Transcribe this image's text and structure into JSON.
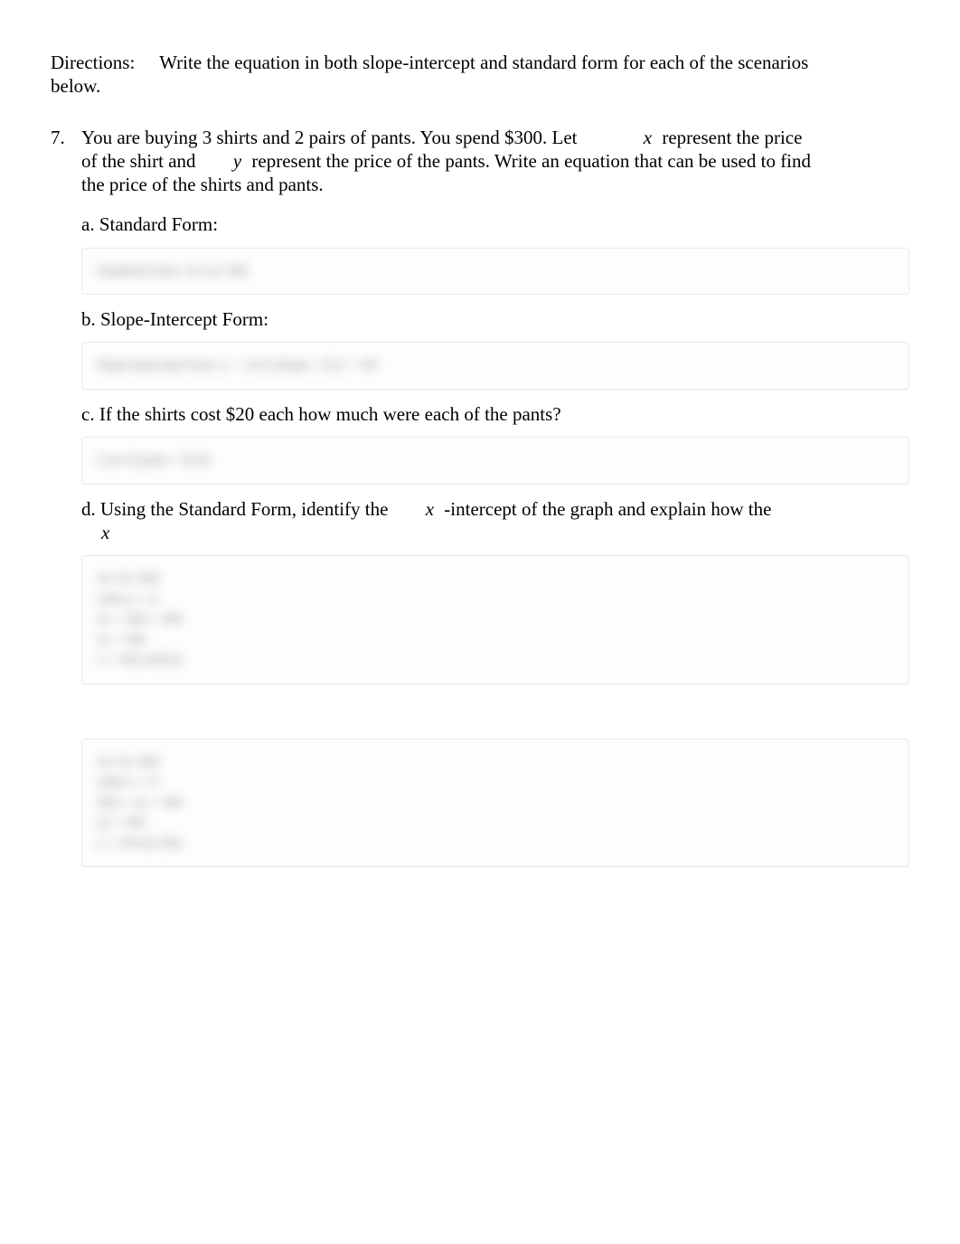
{
  "directions": {
    "label": "Directions:",
    "text": "Write the equation in both slope-intercept and standard form for each of the scenarios below."
  },
  "problem": {
    "number": "7.",
    "text_part1": "You are buying 3 shirts and 2 pairs of pants. You spend $300. Let",
    "var_x": "x",
    "text_part2": "represent the price of the shirt and",
    "var_y": "y",
    "text_part3": "represent the price of the pants. Write an equation that can be used to find the price of the shirts and pants.",
    "parts": {
      "a": {
        "label": "a. Standard Form:",
        "hidden": "Standard Form: 3x+2y=300"
      },
      "b": {
        "label": "b. Slope-Intercept Form:",
        "hidden": "Slope-Intercept Form: y = -3x/2 (Slope: -3/2) + 150"
      },
      "c": {
        "label": "c. If the shirts cost $20 each how much were each of the pants?",
        "hidden": "Cost of pants = $120"
      },
      "d": {
        "label_part1": "d. Using the Standard Form, identify the",
        "label_var": "x",
        "label_part2": "-intercept of the graph and explain how the",
        "label_var2": "x",
        "hidden": "3x+2y=300\nwhen y = 0\n3x + 2(0) = 300\n3x = 300\nx = 100  (100,0)"
      },
      "e": {
        "hidden": "3x+2y=300\nwhen x = 0\n3(0) + 2y = 300\n2y = 300\ny = 150  (0,150)"
      }
    }
  }
}
